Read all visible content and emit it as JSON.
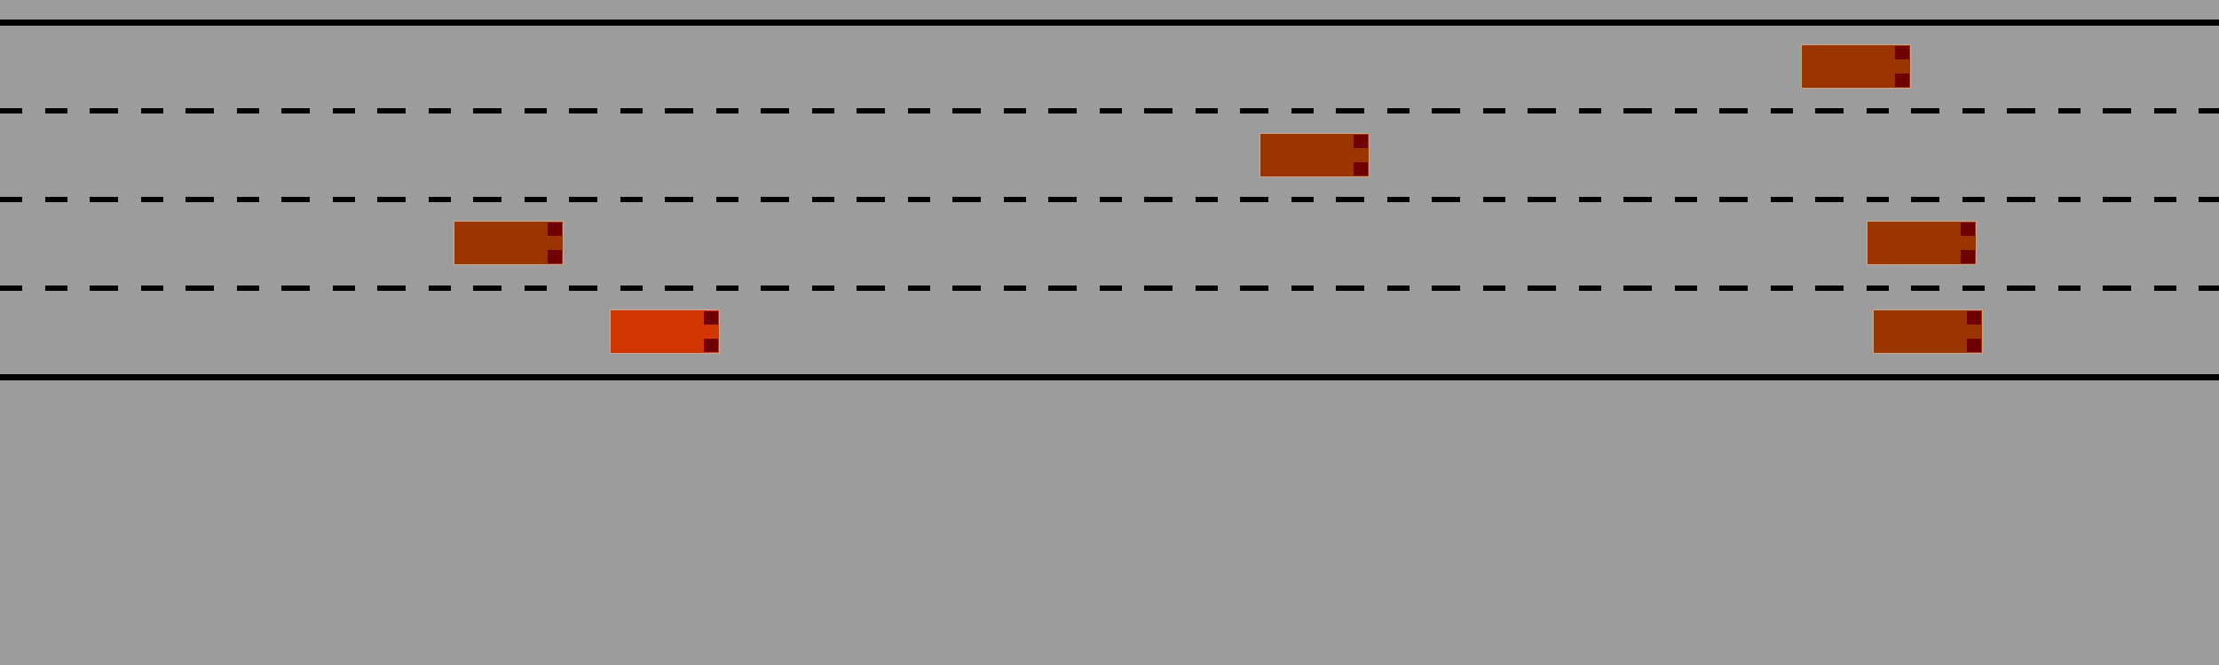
{
  "scene": {
    "road_color": "#9c9c9c",
    "line_color": "#000000",
    "lane_count": 4,
    "tail_light_color": "#6e0000"
  },
  "player_car": {
    "lane": 4,
    "color": "#d13600"
  },
  "traffic_cars": [
    {
      "lane": 1,
      "color": "#9a3500"
    },
    {
      "lane": 2,
      "color": "#9a3500"
    },
    {
      "lane": 3,
      "color": "#9a3500"
    },
    {
      "lane": 3,
      "color": "#9a3500"
    },
    {
      "lane": 4,
      "color": "#9a3500"
    }
  ]
}
